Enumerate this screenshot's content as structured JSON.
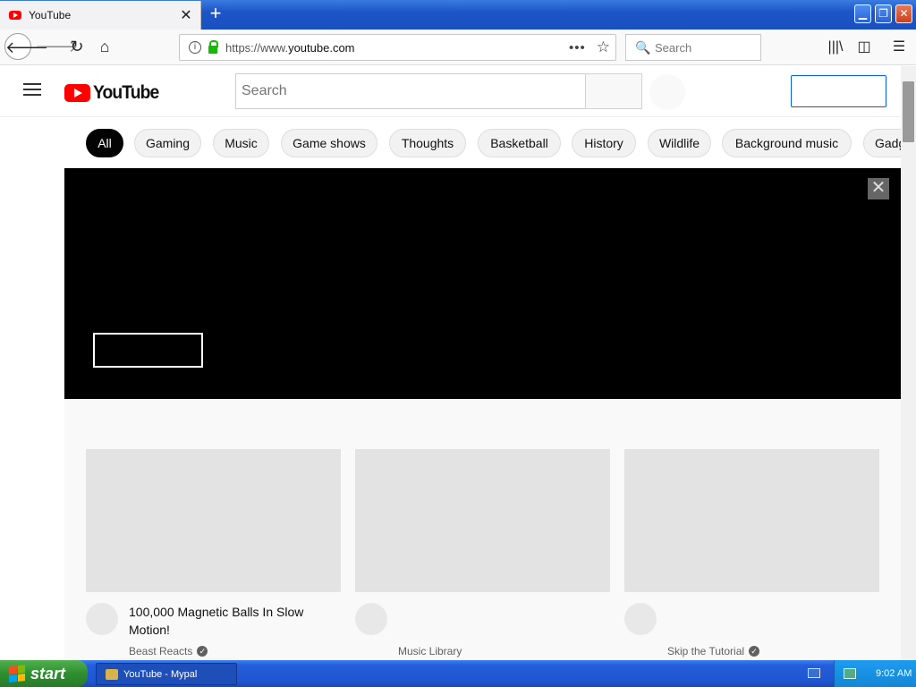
{
  "browser": {
    "tab_title": "YouTube",
    "tab_close": "✕",
    "new_tab": "+",
    "url_prefix": "https://www.",
    "url_domain": "youtube.com",
    "url_more": "•••",
    "search_placeholder": "Search"
  },
  "youtube": {
    "logo_text": "YouTube",
    "search_placeholder": "Search",
    "chips": [
      "All",
      "Gaming",
      "Music",
      "Game shows",
      "Thoughts",
      "Basketball",
      "History",
      "Wildlife",
      "Background music",
      "Gadg"
    ],
    "banner_close": "✕",
    "videos": [
      {
        "title": "100,000 Magnetic Balls In Slow Motion!",
        "channel": "Beast Reacts",
        "verified": true
      },
      {
        "title": "",
        "channel": "Music Library",
        "verified": false
      },
      {
        "title": "",
        "channel": "Skip the Tutorial",
        "verified": true
      }
    ]
  },
  "taskbar": {
    "start_label": "start",
    "task_label": "YouTube - Mypal",
    "clock": "9:02 AM"
  },
  "colors": {
    "yt_red": "#ff0000",
    "chip_active": "#030303",
    "signin_blue": "#065fd4",
    "xp_blue": "#245ddb",
    "start_green": "#2f8f2f"
  }
}
